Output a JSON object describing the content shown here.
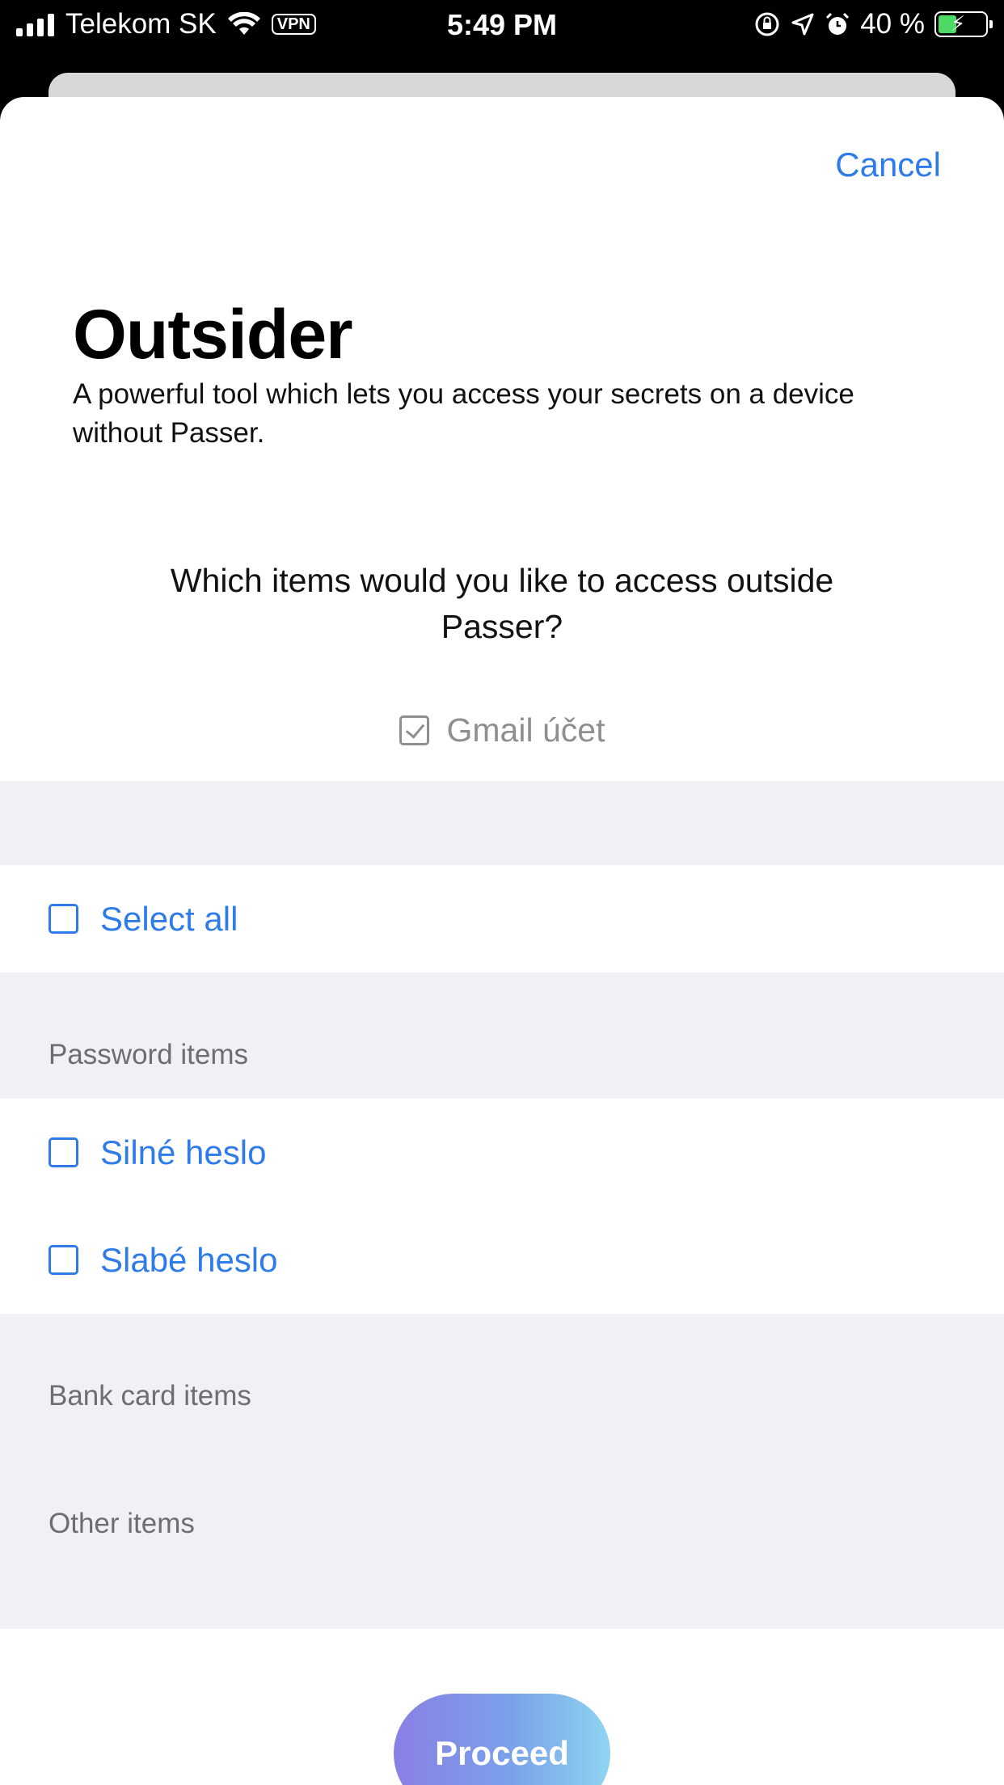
{
  "status_bar": {
    "carrier": "Telekom SK",
    "vpn_label": "VPN",
    "time": "5:49 PM",
    "battery_percent": "40 %",
    "battery_level": 0.4
  },
  "sheet": {
    "cancel_label": "Cancel",
    "title": "Outsider",
    "subtitle": "A powerful tool which lets you access your secrets on a device without Passer.",
    "question": "Which items would you like to access outside Passer?",
    "selected_item": "Gmail účet"
  },
  "list": {
    "select_all_label": "Select all",
    "sections": [
      {
        "header": "Password items",
        "items": [
          "Silné heslo",
          "Slabé heslo"
        ]
      },
      {
        "header": "Bank card items",
        "items": []
      },
      {
        "header": "Other items",
        "items": []
      }
    ]
  },
  "footer": {
    "proceed_label": "Proceed"
  },
  "colors": {
    "accent": "#2f7ce8",
    "group_background": "#f1f1f5",
    "secondary_text": "#6d6d72"
  }
}
